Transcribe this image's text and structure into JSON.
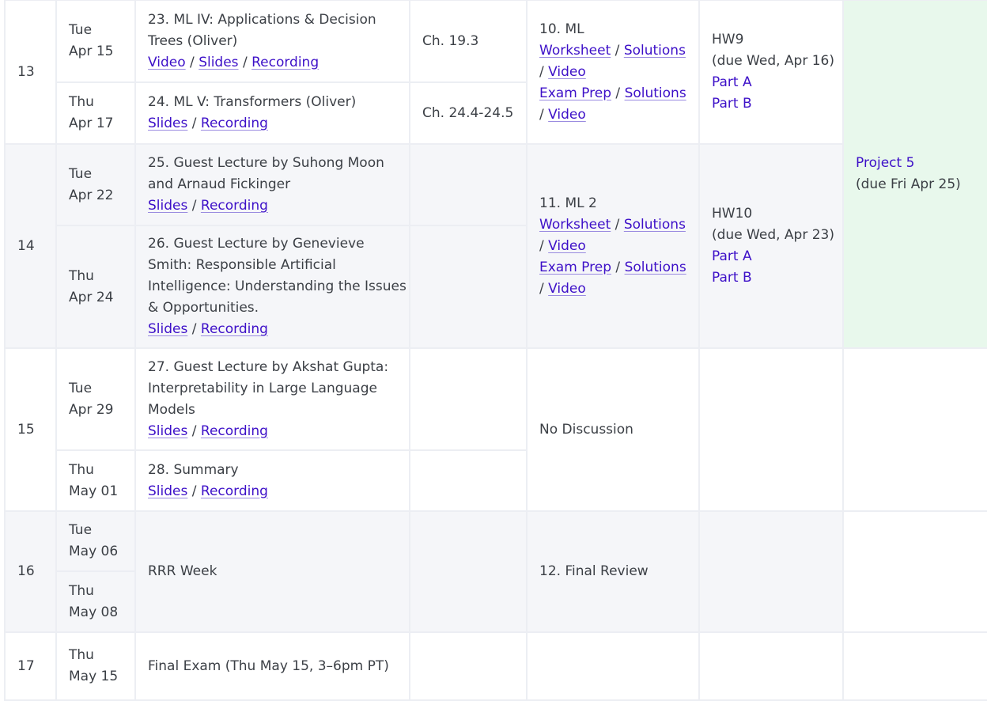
{
  "rows": [
    {
      "week": "13",
      "lectures": [
        {
          "day": "Tue",
          "date": "Apr 15",
          "title": "23. ML IV: Applications & Decision Trees (Oliver)",
          "links": [
            "Video",
            "Slides",
            "Recording"
          ],
          "reading": "Ch. 19.3"
        },
        {
          "day": "Thu",
          "date": "Apr 17",
          "title": "24. ML V: Transformers (Oliver)",
          "links": [
            "Slides",
            "Recording"
          ],
          "reading": "Ch. 24.4-24.5"
        }
      ],
      "discussion": {
        "title": "10. ML",
        "worksheet": "Worksheet",
        "solutions": "Solutions",
        "video": "Video",
        "exam_prep": "Exam Prep",
        "ep_solutions": "Solutions",
        "ep_video": "Video"
      },
      "homework": {
        "title": "HW9",
        "due": "(due Wed, Apr 16)",
        "part_a": "Part A",
        "part_b": "Part B"
      }
    },
    {
      "week": "14",
      "lectures": [
        {
          "day": "Tue",
          "date": "Apr 22",
          "title": "25. Guest Lecture by Suhong Moon and Arnaud Fickinger",
          "links": [
            "Slides",
            "Recording"
          ],
          "reading": ""
        },
        {
          "day": "Thu",
          "date": "Apr 24",
          "title": "26. Guest Lecture by Genevieve Smith: Responsible Artificial Intelligence: Understanding the Issues & Opportunities.",
          "links": [
            "Slides",
            "Recording"
          ],
          "reading": ""
        }
      ],
      "discussion": {
        "title": "11. ML 2",
        "worksheet": "Worksheet",
        "solutions": "Solutions",
        "video": "Video",
        "exam_prep": "Exam Prep",
        "ep_solutions": "Solutions",
        "ep_video": "Video"
      },
      "homework": {
        "title": "HW10",
        "due": "(due Wed, Apr 23)",
        "part_a": "Part A",
        "part_b": "Part B"
      }
    },
    {
      "week": "15",
      "lectures": [
        {
          "day": "Tue",
          "date": "Apr 29",
          "title": "27. Guest Lecture by Akshat Gupta: Interpretability in Large Language Models",
          "links": [
            "Slides",
            "Recording"
          ]
        },
        {
          "day": "Thu",
          "date": "May 01",
          "title": "28. Summary",
          "links": [
            "Slides",
            "Recording"
          ]
        }
      ],
      "discussion": {
        "title": "No Discussion"
      }
    },
    {
      "week": "16",
      "lectures": [
        {
          "day": "Tue",
          "date": "May 06"
        },
        {
          "day": "Thu",
          "date": "May 08"
        }
      ],
      "topic": "RRR Week",
      "discussion": {
        "title": "12. Final Review"
      }
    },
    {
      "week": "17",
      "lectures": [
        {
          "day": "Thu",
          "date": "May 15"
        }
      ],
      "topic": "Final Exam (Thu May 15, 3–6pm PT)"
    }
  ],
  "project": {
    "title": "Project 5",
    "due": "(due Fri Apr 25)"
  },
  "link_sep": "/",
  "colors": {
    "link": "#3d10c8",
    "text": "#3b3f45",
    "shade": "#f5f6f9",
    "project_bg": "#e8f8ec",
    "border": "#eceef3"
  }
}
